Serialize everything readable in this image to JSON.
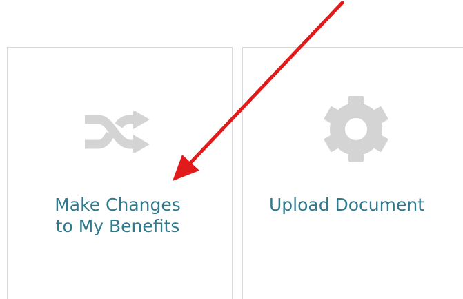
{
  "tiles": [
    {
      "label_line1": "Make Changes",
      "label_line2": "to My Benefits",
      "icon": "shuffle-icon"
    },
    {
      "label_line1": "Upload Document",
      "icon": "gear-icon"
    }
  ],
  "annotation": {
    "type": "arrow",
    "color": "#e11b1b",
    "points_to": "make-changes-tile"
  },
  "colors": {
    "label_text": "#2f7a8c",
    "icon_gray": "#d4d4d4",
    "tile_border": "#d9d9d9",
    "background": "#ffffff"
  }
}
